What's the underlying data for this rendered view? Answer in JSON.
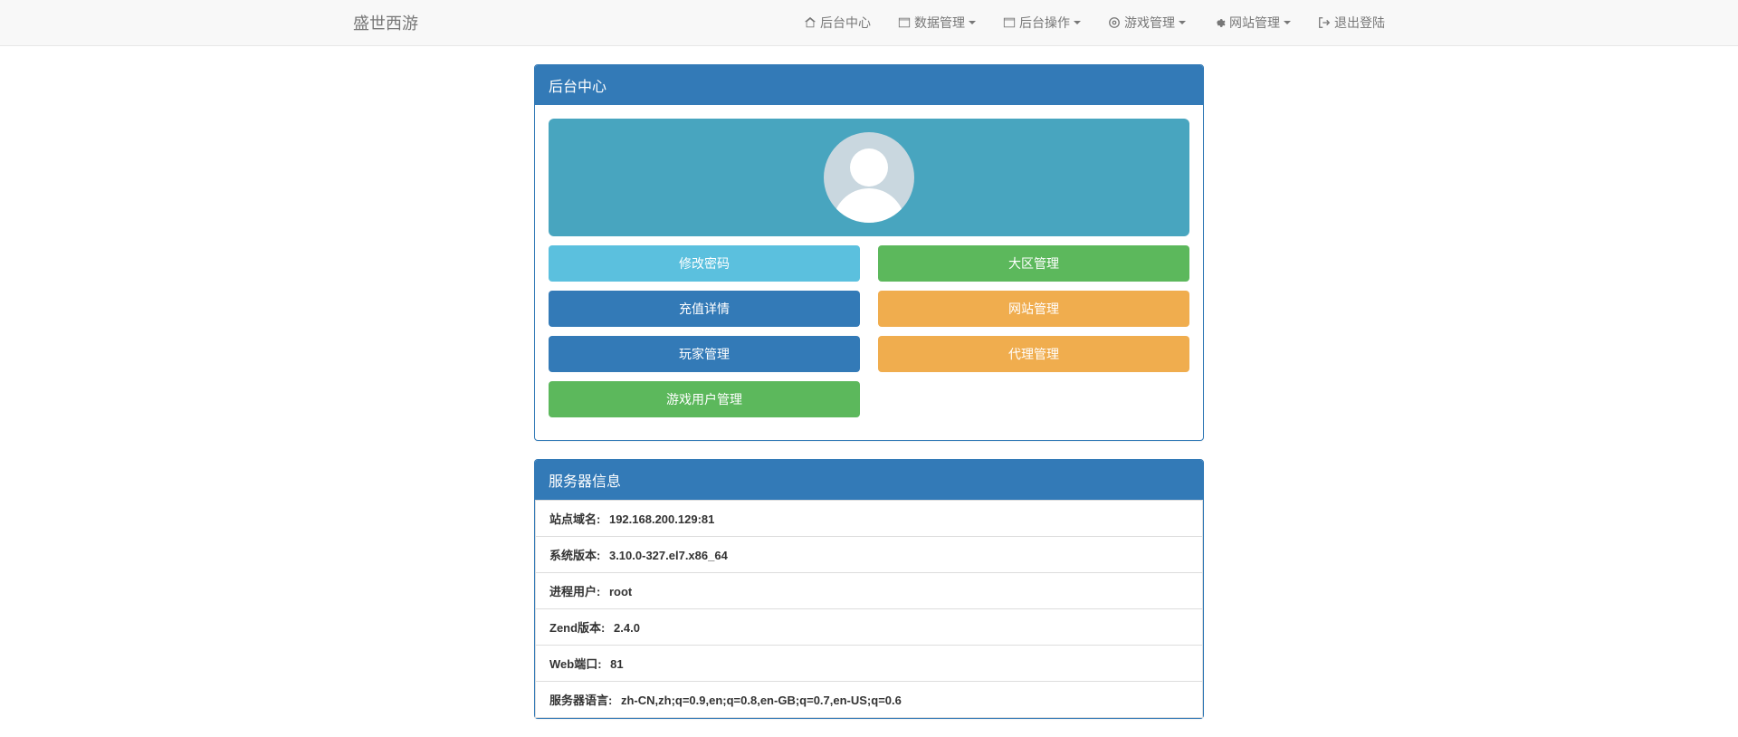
{
  "brand": "盛世西游",
  "nav": {
    "home": "后台中心",
    "data": "数据管理",
    "ops": "后台操作",
    "game": "游戏管理",
    "site": "网站管理",
    "logout": "退出登陆"
  },
  "panel1": {
    "title": "后台中心",
    "buttons": {
      "change_pw": "修改密码",
      "zone": "大区管理",
      "recharge": "充值详情",
      "website": "网站管理",
      "player": "玩家管理",
      "agent": "代理管理",
      "game_user": "游戏用户管理"
    }
  },
  "panel2": {
    "title": "服务器信息",
    "rows": {
      "domain_label": "站点域名:",
      "domain_value": "192.168.200.129:81",
      "sys_label": "系统版本:",
      "sys_value": "3.10.0-327.el7.x86_64",
      "proc_label": "进程用户:",
      "proc_value": "root",
      "zend_label": "Zend版本:",
      "zend_value": "2.4.0",
      "port_label": "Web端口:",
      "port_value": "81",
      "lang_label": "服务器语言:",
      "lang_value": "zh-CN,zh;q=0.9,en;q=0.8,en-GB;q=0.7,en-US;q=0.6"
    }
  }
}
